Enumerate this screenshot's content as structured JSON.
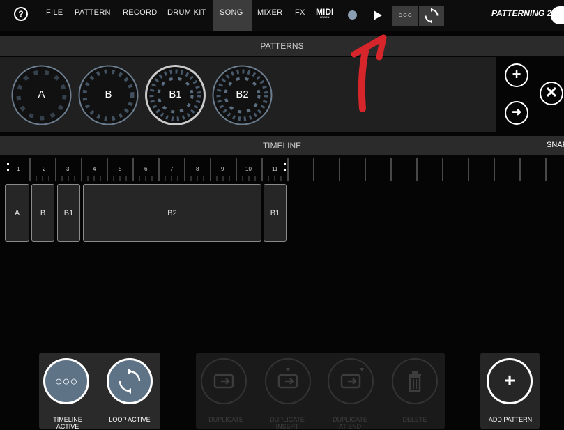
{
  "menu": {
    "help": "?",
    "items": [
      "FILE",
      "PATTERN",
      "RECORD",
      "DRUM KIT",
      "SONG",
      "MIXER",
      "FX"
    ],
    "active": "SONG",
    "midi_label": "MIDI",
    "midi_sub": "LEARN",
    "loop_glyph": "○○○",
    "app_name": "PATTERNING 2"
  },
  "patterns_section": {
    "title": "PATTERNS",
    "patterns": [
      {
        "label": "A",
        "selected": false
      },
      {
        "label": "B",
        "selected": false
      },
      {
        "label": "B1",
        "selected": true
      },
      {
        "label": "B2",
        "selected": false
      }
    ],
    "add_glyph": "+",
    "close_glyph": "✕",
    "arrow_glyph": "➜"
  },
  "timeline_section": {
    "title": "TIMELINE",
    "snap_label": "SNAP",
    "ruler": [
      "1",
      "2",
      "3",
      "4",
      "5",
      "6",
      "7",
      "8",
      "9",
      "10",
      "11"
    ],
    "blocks": [
      {
        "label": "A",
        "start": 1,
        "length": 1
      },
      {
        "label": "B",
        "start": 2,
        "length": 1
      },
      {
        "label": "B1",
        "start": 3,
        "length": 1
      },
      {
        "label": "B2",
        "start": 4,
        "length": 7
      },
      {
        "label": "B1",
        "start": 11,
        "length": 1
      }
    ]
  },
  "bottom": {
    "timeline_active": "TIMELINE\nACTIVE",
    "loop_active": "LOOP ACTIVE",
    "duplicate": "DUPLICATE",
    "duplicate_insert": "DUPLICATE\nINSERT",
    "duplicate_at_end": "DUPLICATE\nAT END",
    "delete": "DELETE",
    "add_pattern": "ADD PATTERN"
  },
  "annotation": {
    "arrow_color": "#d6262b"
  },
  "colors": {
    "accent": "#8c9fb2",
    "active_circle": "#5f7387"
  }
}
